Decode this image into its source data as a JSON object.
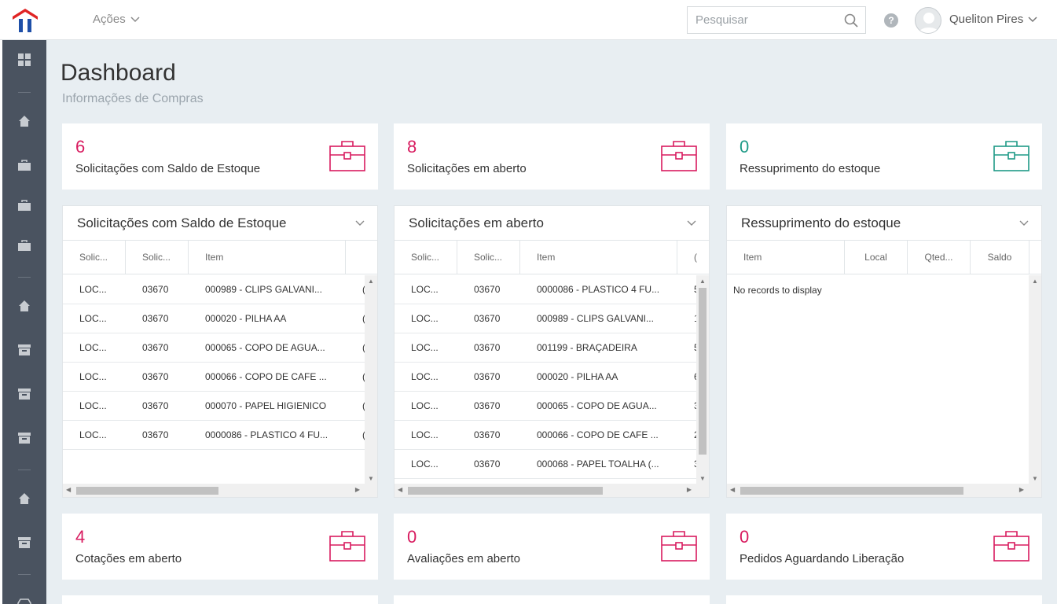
{
  "topbar": {
    "acoes_label": "Ações",
    "search_placeholder": "Pesquisar",
    "help_label": "?",
    "user_name": "Queliton Pires"
  },
  "sidebar": {
    "icons": [
      "dashboard-icon",
      "home-icon",
      "briefcase-icon",
      "briefcase-icon",
      "briefcase-icon",
      "home-icon",
      "archive-icon",
      "archive-icon",
      "archive-icon",
      "home-icon",
      "archive-icon",
      "truck-icon"
    ]
  },
  "page": {
    "title": "Dashboard",
    "subtitle": "Informações de Compras"
  },
  "stats_top": [
    {
      "value": "6",
      "label": "Solicitações com Saldo de Estoque",
      "color": "#d81b5f"
    },
    {
      "value": "8",
      "label": "Solicitações em aberto",
      "color": "#d81b5f"
    },
    {
      "value": "0",
      "label": "Ressuprimento do estoque",
      "color": "#1f9a87"
    }
  ],
  "stats_bottom": [
    {
      "value": "4",
      "label": "Cotações em aberto",
      "color": "#d81b5f"
    },
    {
      "value": "0",
      "label": "Avaliações em aberto",
      "color": "#d81b5f"
    },
    {
      "value": "0",
      "label": "Pedidos Aguardando Liberação",
      "color": "#d81b5f"
    }
  ],
  "panels": [
    {
      "title": "Solicitações com Saldo de Estoque",
      "columns": [
        "Solic...",
        "Solic...",
        "Item",
        ""
      ],
      "rows": [
        [
          "LOC...",
          "03670",
          "000989 - CLIPS GALVANI...",
          "("
        ],
        [
          "LOC...",
          "03670",
          "000020 - PILHA AA",
          "("
        ],
        [
          "LOC...",
          "03670",
          "000065 - COPO DE AGUA...",
          "("
        ],
        [
          "LOC...",
          "03670",
          "000066 - COPO DE CAFE ...",
          "("
        ],
        [
          "LOC...",
          "03670",
          "000070 - PAPEL HIGIENICO",
          "("
        ],
        [
          "LOC...",
          "03670",
          "0000086 - PLASTICO 4 FU...",
          "("
        ]
      ]
    },
    {
      "title": "Solicitações em aberto",
      "columns": [
        "Solic...",
        "Solic...",
        "Item",
        "("
      ],
      "rows": [
        [
          "LOC...",
          "03670",
          "0000086 - PLASTICO 4 FU...",
          "5"
        ],
        [
          "LOC...",
          "03670",
          "000989 - CLIPS GALVANI...",
          "1"
        ],
        [
          "LOC...",
          "03670",
          "001199 - BRAÇADEIRA",
          "5"
        ],
        [
          "LOC...",
          "03670",
          "000020 - PILHA AA",
          "6"
        ],
        [
          "LOC...",
          "03670",
          "000065 - COPO DE AGUA...",
          "3"
        ],
        [
          "LOC...",
          "03670",
          "000066 - COPO DE CAFE ...",
          "2"
        ],
        [
          "LOC...",
          "03670",
          "000068 - PAPEL TOALHA (...",
          "3"
        ]
      ]
    },
    {
      "title": "Ressuprimento do estoque",
      "columns": [
        "Item",
        "Local",
        "Qted...",
        "Saldo"
      ],
      "rows": [],
      "empty_text": "No records to display"
    }
  ]
}
